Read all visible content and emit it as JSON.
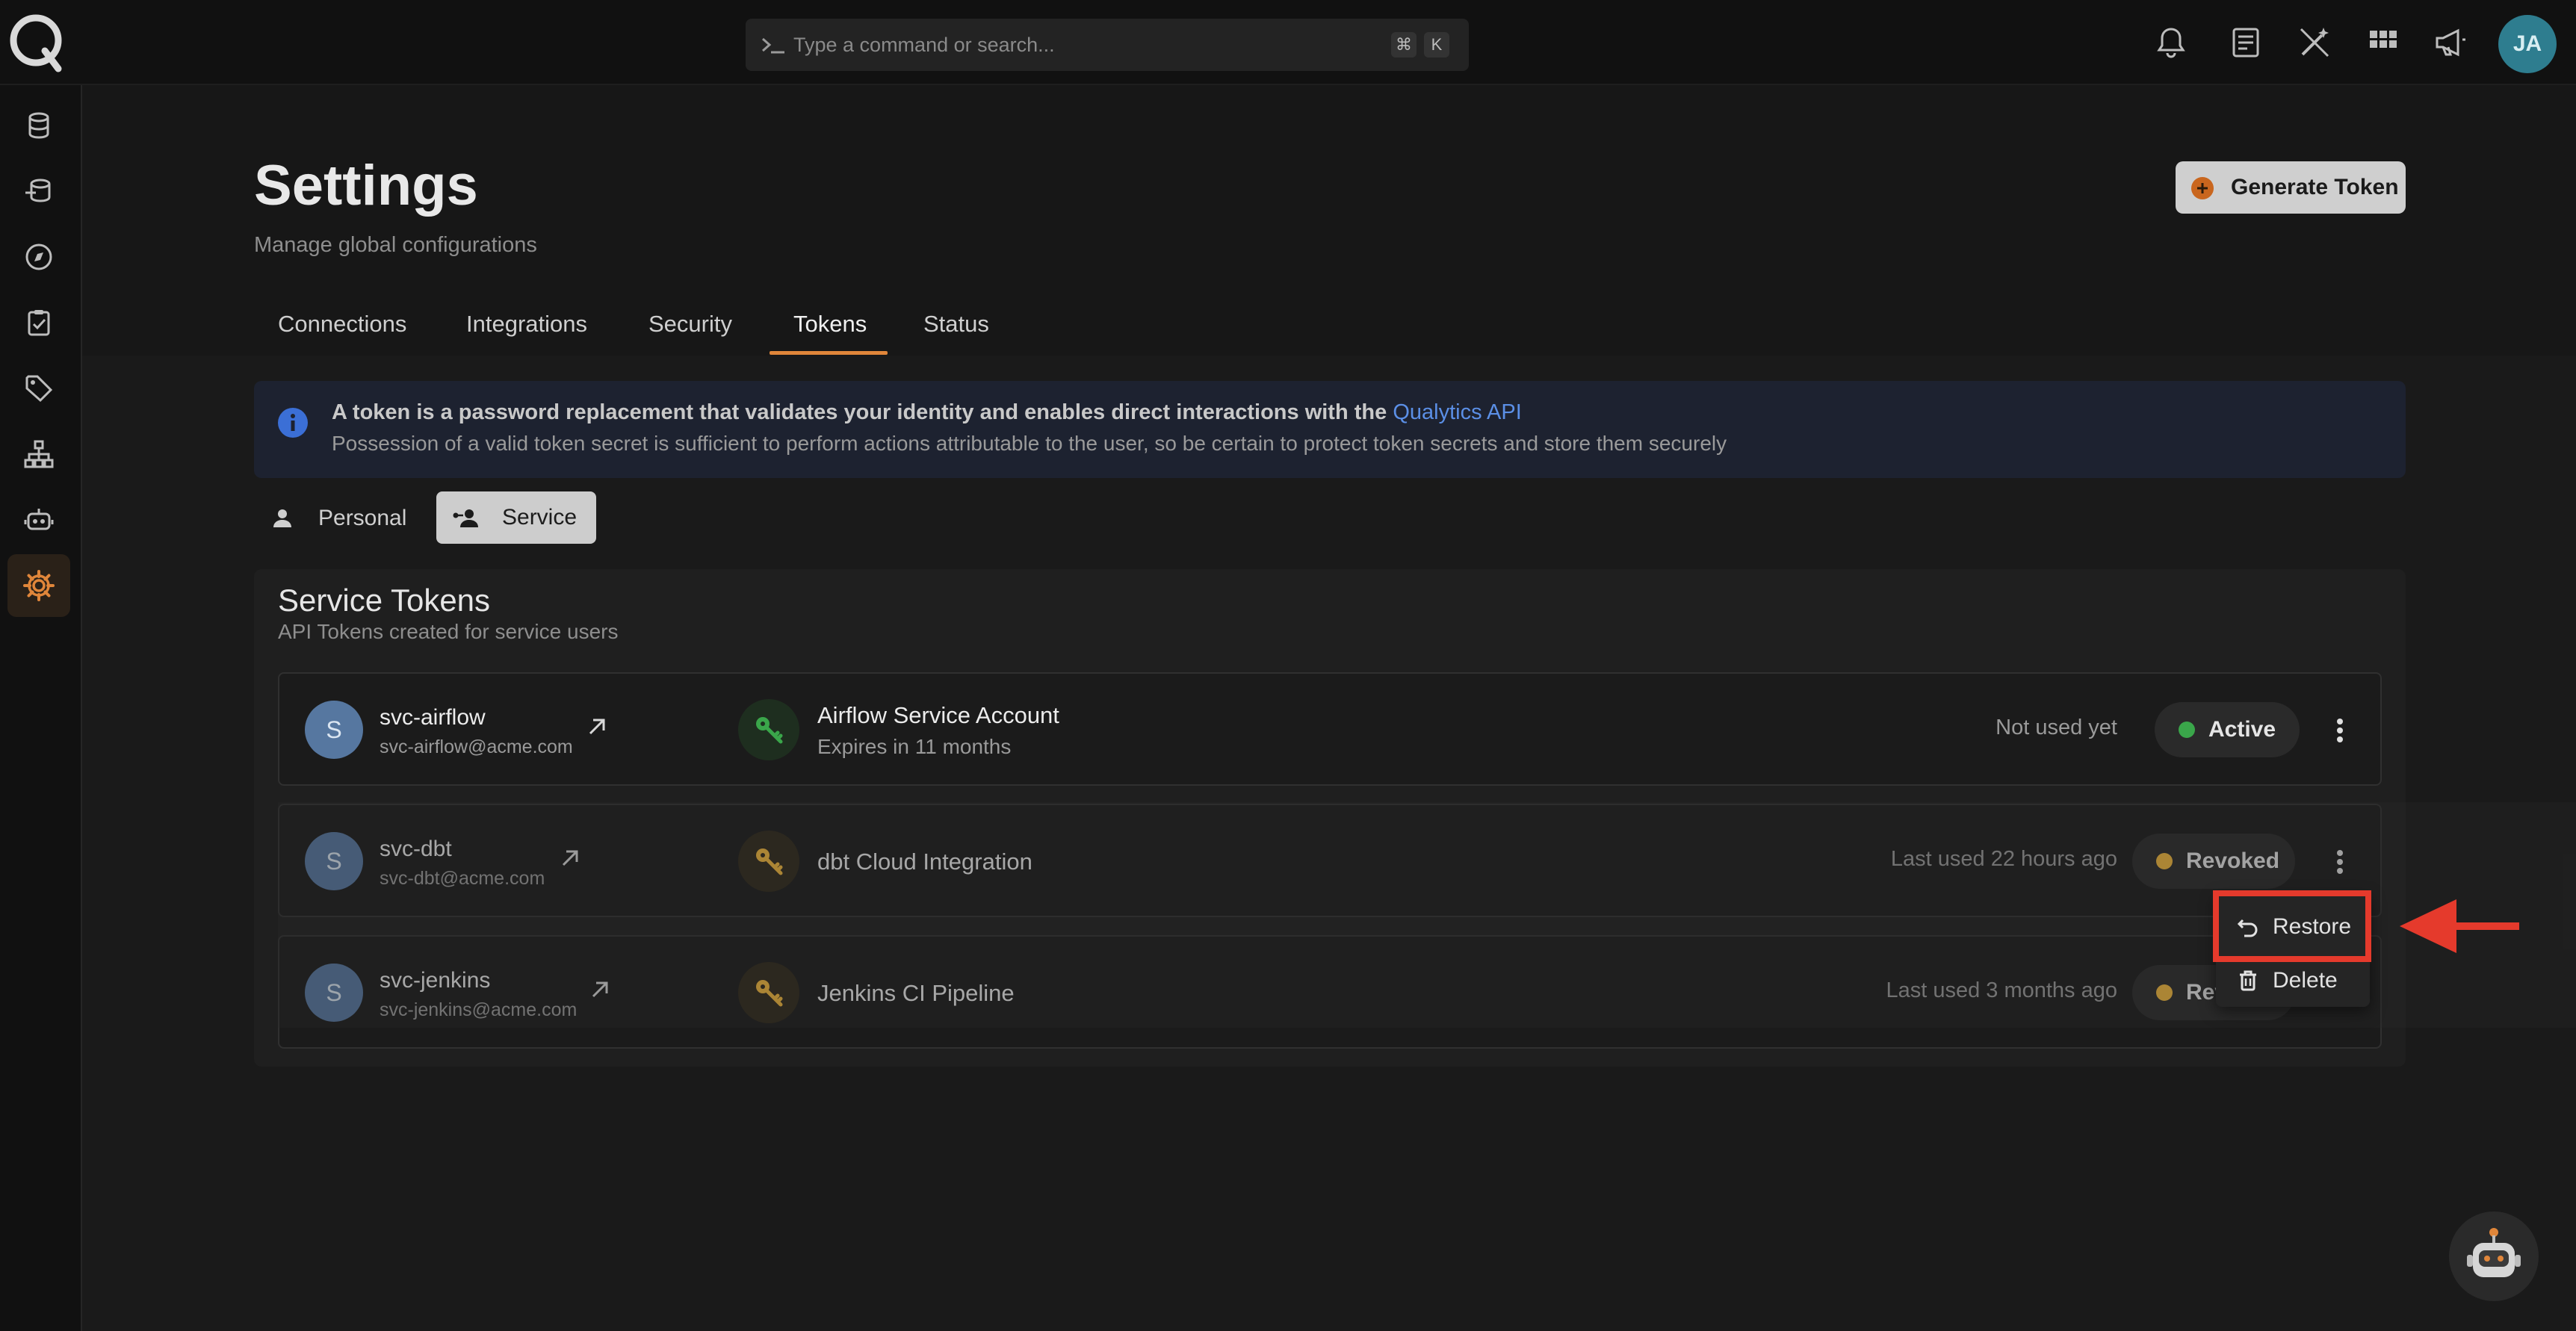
{
  "command_bar": {
    "placeholder": "Type a command or search...",
    "shortcut_mod": "⌘",
    "shortcut_key": "K"
  },
  "topbar_icons": [
    "bell-icon",
    "notes-icon",
    "magic-wand-icon",
    "apps-grid-icon",
    "megaphone-icon"
  ],
  "user": {
    "initials": "JA"
  },
  "sidebar": [
    "database-icon",
    "data-stack-icon",
    "compass-icon",
    "checklist-icon",
    "tag-icon",
    "hierarchy-icon",
    "robot-icon",
    "gear-icon"
  ],
  "header": {
    "title": "Settings",
    "subtitle": "Manage global configurations",
    "generate_button": "Generate Token"
  },
  "tabs": [
    "Connections",
    "Integrations",
    "Security",
    "Tokens",
    "Status"
  ],
  "active_tab": "Tokens",
  "banner": {
    "line1": "A token is a password replacement that validates your identity and enables direct interactions with the",
    "link": "Qualytics API",
    "line2": "Possession of a valid token secret is sufficient to perform actions attributable to the user, so be certain to protect token secrets and store them securely"
  },
  "toggle": {
    "personal": "Personal",
    "service": "Service",
    "selected": "Service"
  },
  "card": {
    "title": "Service Tokens",
    "subtitle": "API Tokens created for service users"
  },
  "tokens": [
    {
      "initial": "S",
      "username": "svc-airflow",
      "email": "svc-airflow@acme.com",
      "token_name": "Airflow Service Account",
      "expires": "Expires in 11 months",
      "usage": "Not used yet",
      "status": "Active"
    },
    {
      "initial": "S",
      "username": "svc-dbt",
      "email": "svc-dbt@acme.com",
      "token_name": "dbt Cloud Integration",
      "expires": "",
      "usage": "Last used 22 hours ago",
      "status": "Revoked"
    },
    {
      "initial": "S",
      "username": "svc-jenkins",
      "email": "svc-jenkins@acme.com",
      "token_name": "Jenkins CI Pipeline",
      "expires": "",
      "usage": "Last used 3 months ago",
      "status": "Rev"
    }
  ],
  "context_menu": {
    "restore": "Restore",
    "delete": "Delete"
  },
  "colors": {
    "accent": "#e0863a",
    "active_dot": "#3aa64a",
    "revoked_dot": "#f2b73c",
    "highlight": "#e53a2c",
    "link": "#5b8fe6"
  }
}
